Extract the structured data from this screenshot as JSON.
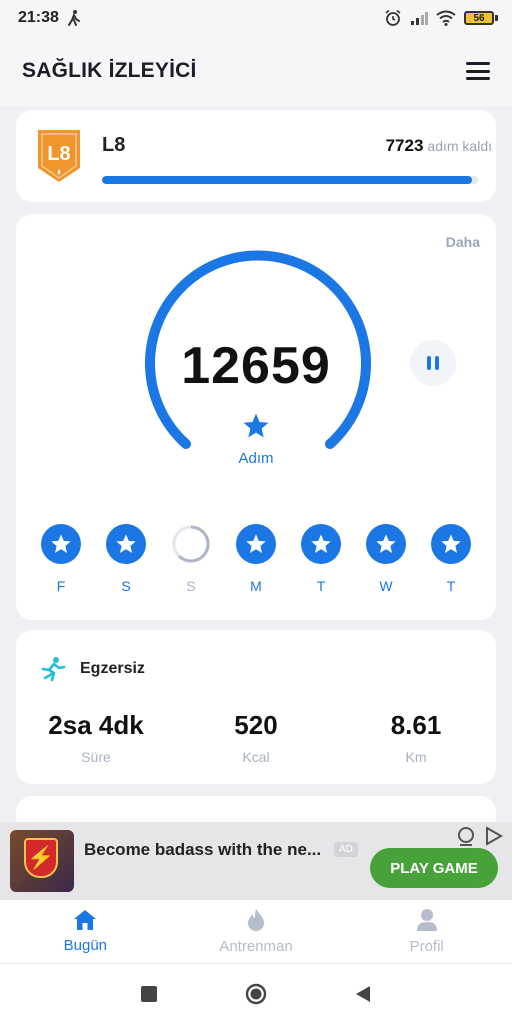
{
  "status_bar": {
    "time": "21:38",
    "battery": "56"
  },
  "app_bar": {
    "title": "SAĞLIK İZLEYİCİ"
  },
  "level": {
    "badge": "L8",
    "label": "L8",
    "remaining_value": "7723",
    "remaining_text": "adım kaldı",
    "progress_fraction": 0.985
  },
  "steps": {
    "more_label": "Daha",
    "count": "12659",
    "unit_label": "Adım"
  },
  "week": [
    {
      "label": "F",
      "done": true
    },
    {
      "label": "S",
      "done": true
    },
    {
      "label": "S",
      "done": false
    },
    {
      "label": "M",
      "done": true
    },
    {
      "label": "T",
      "done": true
    },
    {
      "label": "W",
      "done": true
    },
    {
      "label": "T",
      "done": true
    }
  ],
  "exercise": {
    "title": "Egzersiz",
    "stats": [
      {
        "value": "2sa 4dk",
        "label": "Süre"
      },
      {
        "value": "520",
        "label": "Kcal"
      },
      {
        "value": "8.61",
        "label": "Km"
      }
    ]
  },
  "ad": {
    "text": "Become badass with the ne...",
    "tag": "AD",
    "cta": "PLAY GAME"
  },
  "bottom_nav": [
    {
      "label": "Bugün",
      "icon": "home-icon",
      "active": true
    },
    {
      "label": "Antrenman",
      "icon": "flame-icon",
      "active": false
    },
    {
      "label": "Profil",
      "icon": "person-icon",
      "active": false
    }
  ],
  "colors": {
    "accent": "#1a77e4",
    "ad_cta": "#47a23a",
    "badge": "#f0962e"
  }
}
